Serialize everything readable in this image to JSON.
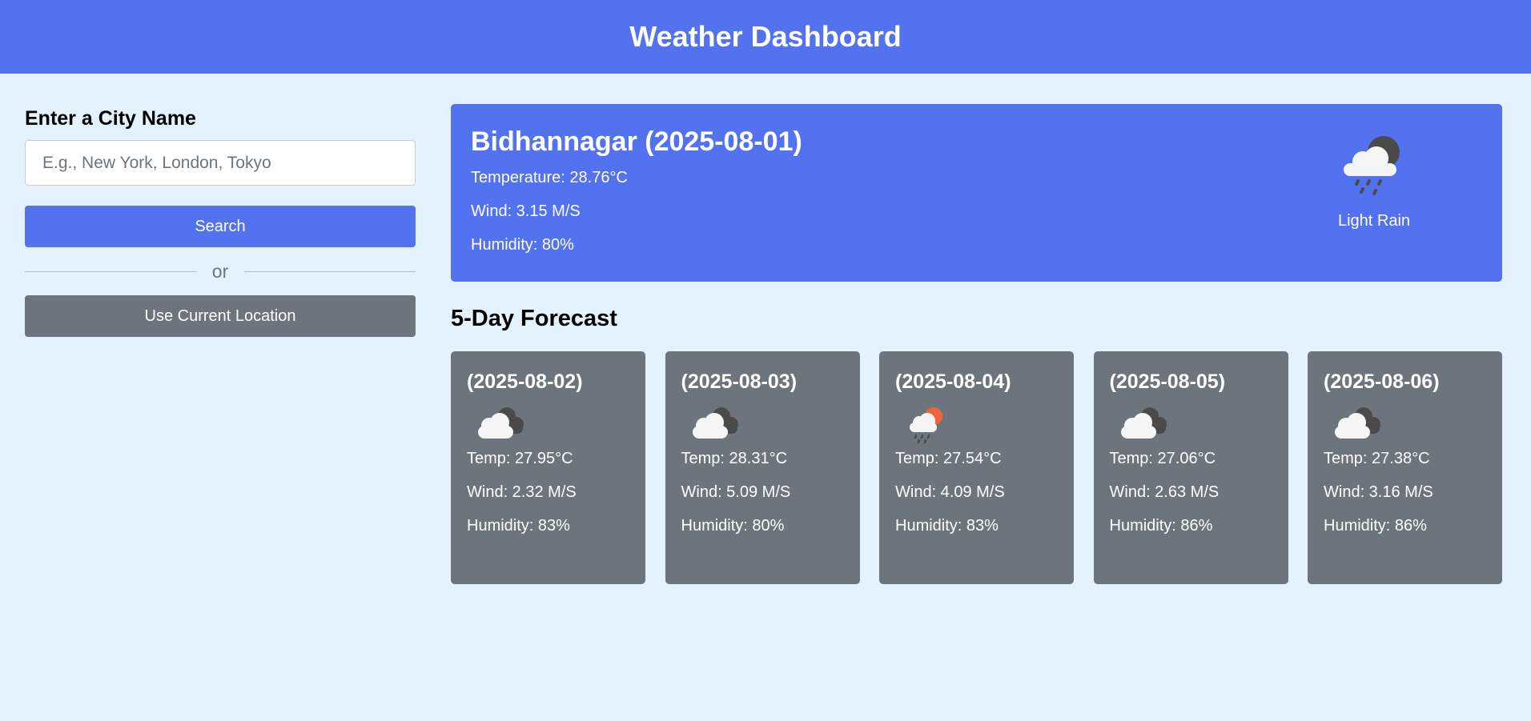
{
  "header": {
    "title": "Weather Dashboard"
  },
  "search": {
    "heading": "Enter a City Name",
    "placeholder": "E.g., New York, London, Tokyo",
    "value": "",
    "search_label": "Search",
    "separator_label": "or",
    "location_label": "Use Current Location"
  },
  "current": {
    "title": "Bidhannagar (2025-08-01)",
    "temperature": "Temperature: 28.76°C",
    "wind": "Wind: 3.15 M/S",
    "humidity": "Humidity: 80%",
    "description": "Light Rain",
    "icon": "light-rain-night-icon"
  },
  "forecast": {
    "title": "5-Day Forecast",
    "days": [
      {
        "date": "(2025-08-02)",
        "temp": "Temp: 27.95°C",
        "wind": "Wind: 2.32 M/S",
        "humidity": "Humidity: 83%",
        "icon": "broken-clouds-icon"
      },
      {
        "date": "(2025-08-03)",
        "temp": "Temp: 28.31°C",
        "wind": "Wind: 5.09 M/S",
        "humidity": "Humidity: 80%",
        "icon": "broken-clouds-icon"
      },
      {
        "date": "(2025-08-04)",
        "temp": "Temp: 27.54°C",
        "wind": "Wind: 4.09 M/S",
        "humidity": "Humidity: 83%",
        "icon": "light-rain-day-icon"
      },
      {
        "date": "(2025-08-05)",
        "temp": "Temp: 27.06°C",
        "wind": "Wind: 2.63 M/S",
        "humidity": "Humidity: 86%",
        "icon": "broken-clouds-icon"
      },
      {
        "date": "(2025-08-06)",
        "temp": "Temp: 27.38°C",
        "wind": "Wind: 3.16 M/S",
        "humidity": "Humidity: 86%",
        "icon": "broken-clouds-icon"
      }
    ]
  },
  "colors": {
    "primary": "#5372f0",
    "secondary": "#6c757d",
    "background": "#e3f2fd",
    "sun": "#f0643c",
    "dark_cloud": "#4a4a4a"
  }
}
